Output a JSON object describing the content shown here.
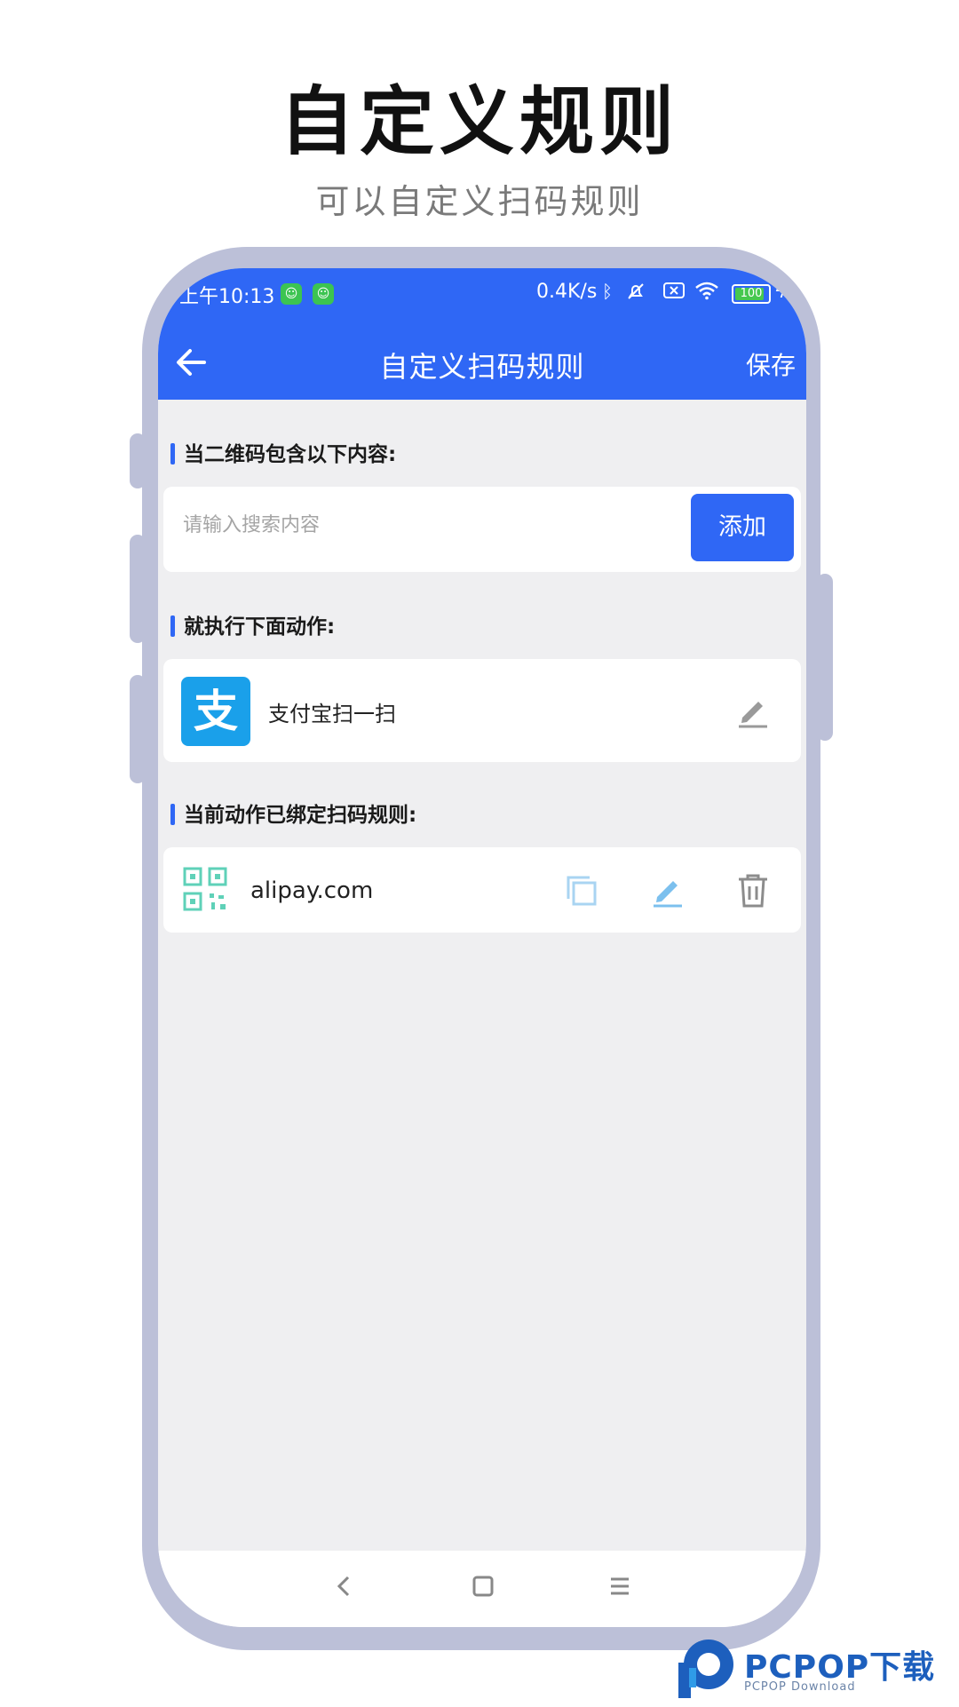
{
  "promo": {
    "title": "自定义规则",
    "subtitle": "可以自定义扫码规则"
  },
  "status_bar": {
    "time": "上午10:13",
    "network_speed": "0.4K/s",
    "battery": "100"
  },
  "nav": {
    "title": "自定义扫码规则",
    "save_label": "保存"
  },
  "condition_section": {
    "heading": "当二维码包含以下内容:",
    "input_placeholder": "请输入搜索内容",
    "input_value": "",
    "add_label": "添加"
  },
  "action_section": {
    "heading": "就执行下面动作:",
    "action": {
      "logo_char": "支",
      "label": "支付宝扫一扫"
    }
  },
  "rules_section": {
    "heading": "当前动作已绑定扫码规则:",
    "rules": [
      {
        "text": "alipay.com"
      }
    ]
  },
  "watermark": {
    "text": "PCPOP下载",
    "sub": "PCPOP Download"
  },
  "colors": {
    "primary": "#2f67f5",
    "alipay": "#1aa0ea",
    "frame": "#bcc0d8",
    "qr": "#5fd1b8",
    "background": "#efeff1"
  }
}
